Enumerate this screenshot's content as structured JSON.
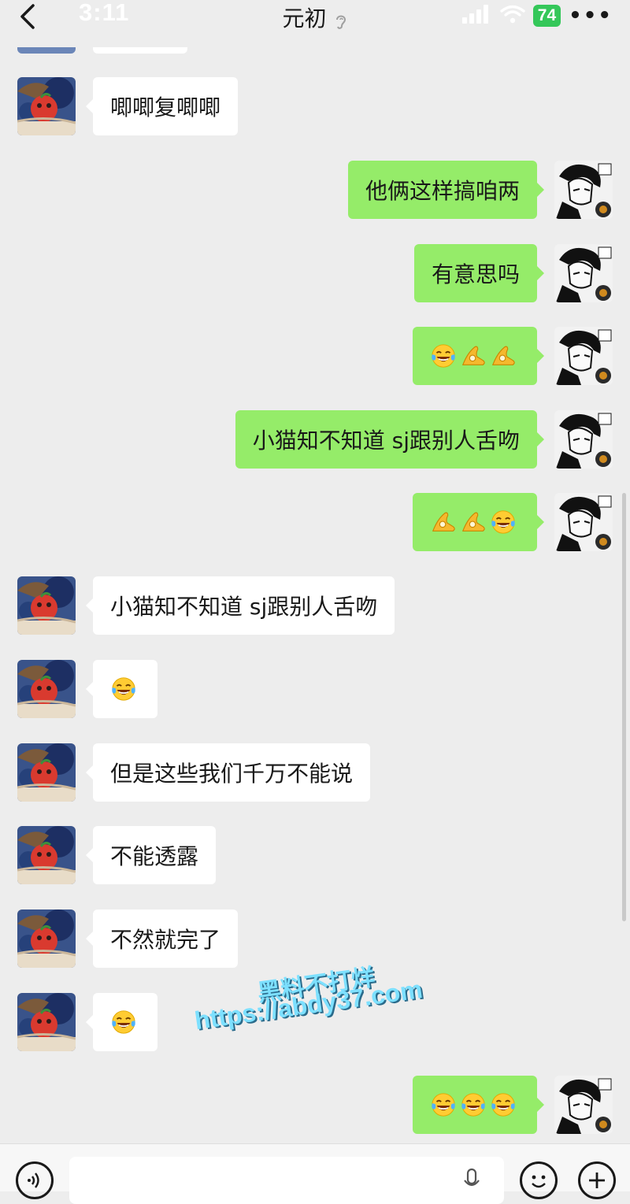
{
  "status_bar": {
    "time": "3:11",
    "battery": "74"
  },
  "header": {
    "title": "元初",
    "more": "•••"
  },
  "messages": [
    {
      "side": "left",
      "text": "唧唧复唧唧"
    },
    {
      "side": "right",
      "text": "他俩这样搞咱两"
    },
    {
      "side": "right",
      "text": "有意思吗"
    },
    {
      "side": "right",
      "emoji": [
        "tears-of-joy",
        "ok-hand",
        "ok-hand"
      ]
    },
    {
      "side": "right",
      "text": "小猫知不知道 sj跟别人舌吻"
    },
    {
      "side": "right",
      "emoji": [
        "ok-hand",
        "ok-hand",
        "tears-of-joy"
      ]
    },
    {
      "side": "left",
      "text": "小猫知不知道 sj跟别人舌吻"
    },
    {
      "side": "left",
      "emoji": [
        "tears-of-joy"
      ]
    },
    {
      "side": "left",
      "text": "但是这些我们千万不能说"
    },
    {
      "side": "left",
      "text": "不能透露"
    },
    {
      "side": "left",
      "text": "不然就完了"
    },
    {
      "side": "left",
      "emoji": [
        "tears-of-joy"
      ]
    },
    {
      "side": "right",
      "emoji": [
        "tears-of-joy",
        "tears-of-joy",
        "tears-of-joy"
      ]
    }
  ],
  "watermark": {
    "line1": "黑料不打烊",
    "line2": "https://abdy37.com"
  },
  "colors": {
    "background": "#ededed",
    "sent_bubble": "#95ec69",
    "received_bubble": "#ffffff",
    "battery": "#34c759"
  },
  "icons": [
    "back-icon",
    "ear-icon",
    "signal-icon",
    "wifi-icon",
    "voice-icon",
    "mic-icon",
    "emoji-icon",
    "plus-icon"
  ]
}
